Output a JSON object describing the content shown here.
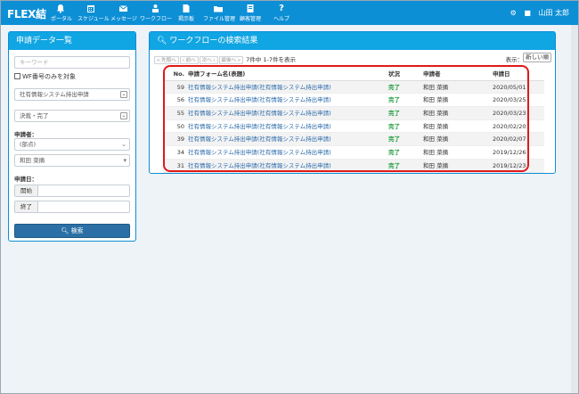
{
  "app": {
    "logo": "FLEX結"
  },
  "nav": [
    {
      "id": "portal",
      "label": "ポータル",
      "icon": "bell-icon"
    },
    {
      "id": "schedule",
      "label": "スケジュール",
      "icon": "calendar-icon"
    },
    {
      "id": "message",
      "label": "メッセージ",
      "icon": "envelope-icon"
    },
    {
      "id": "workflow",
      "label": "ワークフロー",
      "icon": "workflow-icon"
    },
    {
      "id": "board",
      "label": "掲示板",
      "icon": "board-icon"
    },
    {
      "id": "files",
      "label": "ファイル管理",
      "icon": "folder-icon"
    },
    {
      "id": "customers",
      "label": "顧客管理",
      "icon": "customer-icon"
    },
    {
      "id": "help",
      "label": "ヘルプ",
      "icon": "question-icon"
    }
  ],
  "user": {
    "name": "山田 太郎"
  },
  "left_panel": {
    "title": "申請データ一覧",
    "keyword_placeholder": "キーワード",
    "wf_only_label": "WF番号のみを対象",
    "form_select": "社有情報システム持出申請",
    "status_select": "決裁・完了",
    "applicant_label": "申請者：",
    "dept_select": "(部点)",
    "person_select": "和田 菜摘",
    "date_label": "申請日：",
    "start_label": "開始",
    "end_label": "終了",
    "search_button": "検索"
  },
  "right_panel": {
    "title": "ワークフローの検索結果",
    "pager": {
      "first": "« 先頭へ",
      "prev": "‹ 前へ",
      "next": "次へ ›",
      "last": "最後へ »",
      "count": "7件中 1-7件を表示"
    },
    "show_label": "表示：",
    "sort_select": "新しい順",
    "columns": {
      "no": "No.",
      "form": "申請フォーム名(表題)",
      "status": "状況",
      "applicant": "申請者",
      "date": "申請日"
    },
    "rows": [
      {
        "no": "59",
        "form": "社有情報システム持出申請(社有情報システム持出申請)",
        "status": "完了",
        "applicant": "和田 菜摘",
        "date": "2020/05/01"
      },
      {
        "no": "56",
        "form": "社有情報システム持出申請(社有情報システム持出申請)",
        "status": "完了",
        "applicant": "和田 菜摘",
        "date": "2020/03/25"
      },
      {
        "no": "55",
        "form": "社有情報システム持出申請(社有情報システム持出申請)",
        "status": "完了",
        "applicant": "和田 菜摘",
        "date": "2020/03/23"
      },
      {
        "no": "50",
        "form": "社有情報システム持出申請(社有情報システム持出申請)",
        "status": "完了",
        "applicant": "和田 菜摘",
        "date": "2020/02/20"
      },
      {
        "no": "39",
        "form": "社有情報システム持出申請(社有情報システム持出申請)",
        "status": "完了",
        "applicant": "和田 菜摘",
        "date": "2020/02/07"
      },
      {
        "no": "34",
        "form": "社有情報システム持出申請(社有情報システム持出申請)",
        "status": "完了",
        "applicant": "和田 菜摘",
        "date": "2019/12/26"
      },
      {
        "no": "31",
        "form": "社有情報システム持出申請(社有情報システム持出申請)",
        "status": "完了",
        "applicant": "和田 菜摘",
        "date": "2019/12/23"
      }
    ]
  },
  "colors": {
    "nav": "#0d8fd6",
    "panel_head": "#10a5e3",
    "search_button": "#2a6fa5",
    "status_done": "#1c9a3a",
    "highlight": "#e01919"
  }
}
